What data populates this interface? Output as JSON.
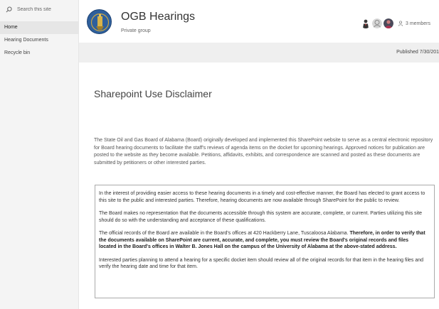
{
  "search": {
    "placeholder": "Search this site"
  },
  "nav": {
    "items": [
      {
        "label": "Home",
        "active": true
      },
      {
        "label": "Hearing Documents",
        "active": false
      },
      {
        "label": "Recycle bin",
        "active": false
      }
    ]
  },
  "header": {
    "title": "OGB Hearings",
    "subtitle": "Private group",
    "members_label": "3 members"
  },
  "cmdbar": {
    "published": "Published 7/30/201"
  },
  "main": {
    "title": "Sharepoint Use Disclaimer",
    "intro": "The State Oil and Gas Board of Alabama (Board) originally developed and implemented this SharePoint website to serve as a central electronic repository for Board hearing documents to facilitate the staff's reviews of agenda items on the docket for upcoming hearings.  Approved notices for publication are posted to the website as they become available.  Petitions, affidavits, exhibits, and correspondence are scanned and posted as these documents are submitted by petitioners or other interested parties.",
    "disclaimer": {
      "p1": "In the interest of providing easier access to these hearing documents in a timely and cost-effective manner, the Board has elected to grant access to this site to the public and interested parties.  Therefore, hearing documents are now available through SharePoint for the public to review.",
      "p2": "The Board makes no representation that the documents accessible through this system are accurate, complete, or current.  Parties utilizing this site should do so with the understanding and acceptance of these qualifications.",
      "p3_plain": "The official records of the Board are available in the Board's offices at 420 Hackberry Lane, Tuscaloosa Alabama.",
      "p3_bold": "Therefore, in order to verify that the documents available on SharePoint are current, accurate, and complete, you must review the Board's original records and files located in the Board's offices in Walter B. Jones Hall on the campus of the University of Alabama at the above-stated address.",
      "p4": "Interested parties planning to attend a hearing for a specific docket item should review all of the original records for that item in the hearing files and verify the hearing date and time for that item."
    }
  },
  "colors": {
    "nav_bg": "#f4f4f4",
    "nav_active": "#e6e6e6",
    "cmdbar_bg": "#efefef",
    "logo_blue": "#2e5f9c"
  },
  "icons": {
    "search": "search-icon",
    "members": "person-icon"
  }
}
